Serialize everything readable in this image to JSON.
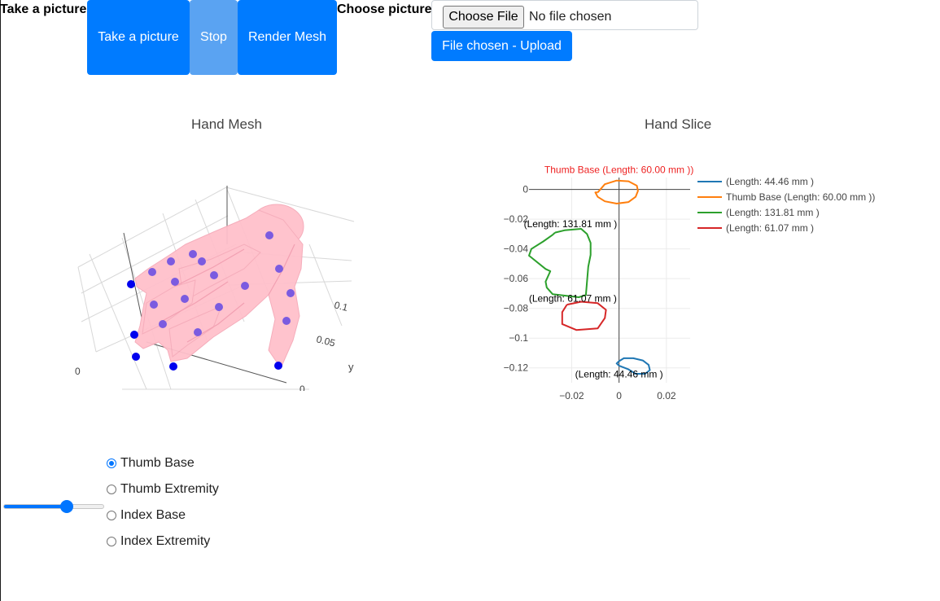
{
  "header": {
    "take_picture_label": "Take a picture",
    "take_picture_button": "Take a picture",
    "stop_button": "Stop",
    "render_mesh_button": "Render Mesh",
    "choose_picture_label": "Choose picture",
    "choose_file_button": "Choose File",
    "file_status": "No file chosen",
    "upload_button": "File chosen - Upload"
  },
  "colors": {
    "primary": "#007bff",
    "primary_disabled": "#5aa3f2",
    "mesh_pink": "#ffc0cb",
    "landmark_purple": "#7b5be0",
    "landmark_blue": "#0000ee"
  },
  "mesh_plot": {
    "title": "Hand Mesh",
    "axis_label_y": "y",
    "tick_labels": [
      "0.1",
      "0.05",
      "0"
    ]
  },
  "chart_data": {
    "type": "line",
    "title": "Hand Slice",
    "xlim": [
      -0.038,
      0.03
    ],
    "ylim": [
      -0.13,
      0.008
    ],
    "x_ticks": [
      -0.02,
      0,
      0.02
    ],
    "x_tick_labels": [
      "−0.02",
      "0",
      "0.02"
    ],
    "y_ticks": [
      0,
      -0.02,
      -0.04,
      -0.06,
      -0.08,
      -0.1,
      -0.12
    ],
    "y_tick_labels": [
      "0",
      "−0.02",
      "−0.04",
      "−0.06",
      "−0.08",
      "−0.1",
      "−0.12"
    ],
    "grid": true,
    "legend_position": "right",
    "series": [
      {
        "name": "(Length: 44.46 mm )",
        "color": "#1f77b4",
        "annotation": "(Length: 44.46 mm )",
        "annotation_color": "#000000",
        "annotation_at": [
          0.0,
          -0.1265
        ],
        "x": [
          0.0,
          0.002,
          0.006,
          0.01,
          0.0125,
          0.013,
          0.011,
          0.007,
          0.004,
          0.0,
          -0.001,
          0.0
        ],
        "y": [
          -0.1155,
          -0.1135,
          -0.1135,
          -0.115,
          -0.118,
          -0.1215,
          -0.124,
          -0.124,
          -0.121,
          -0.1185,
          -0.117,
          -0.1155
        ]
      },
      {
        "name": "Thumb Base (Length:  60.00 mm ))",
        "color": "#ff7f0e",
        "annotation": "Thumb Base (Length:  60.00 mm ))",
        "annotation_color": "#ee2222",
        "annotation_at": [
          0.0,
          0.011
        ],
        "x": [
          -0.009,
          -0.006,
          -0.001,
          0.004,
          0.0075,
          0.008,
          0.007,
          0.004,
          -0.001,
          -0.006,
          -0.009,
          -0.01,
          -0.009
        ],
        "y": [
          -0.002,
          0.0035,
          0.006,
          0.0055,
          0.0025,
          -0.001,
          -0.005,
          -0.0085,
          -0.0095,
          -0.008,
          -0.005,
          -0.002,
          -0.002
        ]
      },
      {
        "name": "(Length: 131.81 mm )",
        "color": "#2ca02c",
        "annotation": "(Length: 131.81 mm )",
        "annotation_color": "#000000",
        "annotation_at": [
          -0.0205,
          -0.0255
        ],
        "x": [
          -0.027,
          -0.023,
          -0.016,
          -0.0135,
          -0.012,
          -0.012,
          -0.013,
          -0.014,
          -0.017,
          -0.028,
          -0.0305,
          -0.031,
          -0.029,
          -0.031,
          -0.038,
          -0.037,
          -0.032,
          -0.028,
          -0.027
        ],
        "y": [
          -0.029,
          -0.0275,
          -0.0265,
          -0.03,
          -0.036,
          -0.044,
          -0.052,
          -0.071,
          -0.0725,
          -0.0705,
          -0.066,
          -0.062,
          -0.055,
          -0.0535,
          -0.0445,
          -0.04,
          -0.035,
          -0.0305,
          -0.029
        ]
      },
      {
        "name": "(Length: 61.07 mm )",
        "color": "#d62728",
        "annotation": "(Length: 61.07 mm )",
        "annotation_color": "#000000",
        "annotation_at": [
          -0.0195,
          -0.0755
        ],
        "x": [
          -0.022,
          -0.016,
          -0.009,
          -0.0055,
          -0.006,
          -0.009,
          -0.018,
          -0.024,
          -0.024,
          -0.022
        ],
        "y": [
          -0.0775,
          -0.0755,
          -0.0765,
          -0.081,
          -0.0865,
          -0.0935,
          -0.0945,
          -0.0905,
          -0.0825,
          -0.0775
        ]
      }
    ]
  },
  "landmark_selector": {
    "options": [
      "Thumb Base",
      "Thumb Extremity",
      "Index Base",
      "Index Extremity"
    ],
    "selected_index": 0
  },
  "slice_slider": {
    "value_fraction": 0.65
  }
}
